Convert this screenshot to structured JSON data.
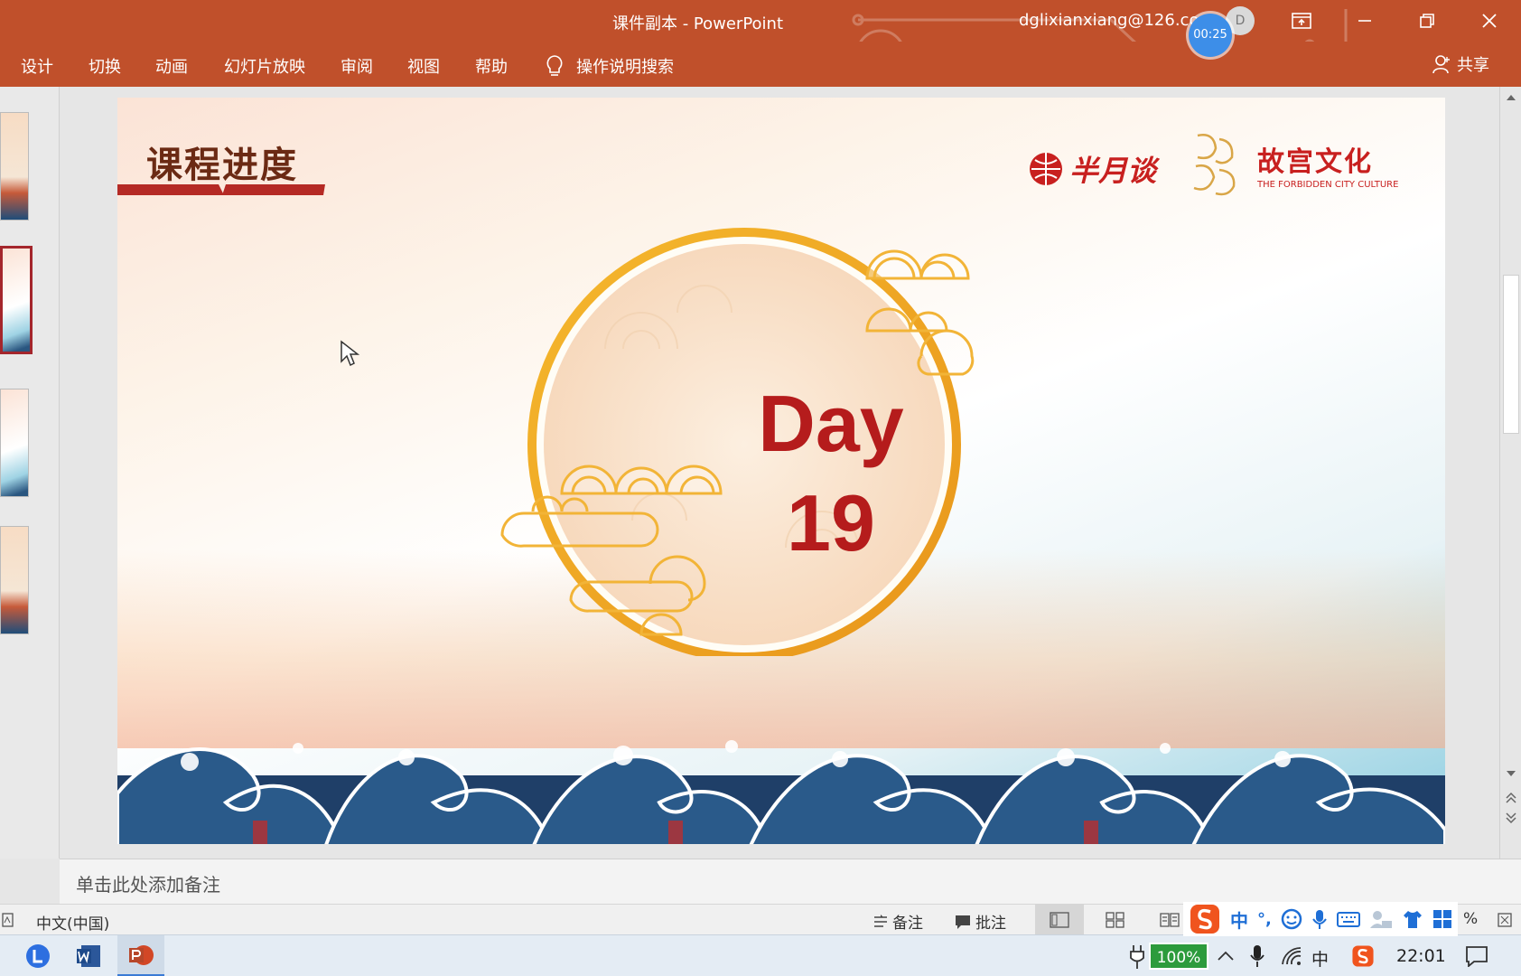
{
  "window": {
    "title": "课件副本  -  PowerPoint",
    "account": "dglixianxiang@126.com",
    "avatar_initial": "D",
    "timer": "00:25"
  },
  "ribbon": {
    "tabs": [
      "设计",
      "切换",
      "动画",
      "幻灯片放映",
      "审阅",
      "视图",
      "帮助"
    ],
    "search_label": "操作说明搜索",
    "share_label": "共享"
  },
  "slide": {
    "title": "课程进度",
    "logo_banyuetan": "半月谈",
    "logo_palace": "故宫文化",
    "logo_palace_en": "THE FORBIDDEN CITY CULTURE",
    "day_word": "Day",
    "day_number": "19"
  },
  "notes": {
    "placeholder": "单击此处添加备注"
  },
  "status": {
    "language": "中文(中国)",
    "notes_label": "备注",
    "comments_label": "批注",
    "zoom_suffix": "%"
  },
  "ime": {
    "mode": "中",
    "punct": "°,"
  },
  "taskbar": {
    "battery": "100%",
    "ime_lang": "中",
    "clock": "22:01"
  },
  "colors": {
    "brand": "#c0502b",
    "day_red": "#b51c1c",
    "title_brown": "#6b2a14"
  }
}
